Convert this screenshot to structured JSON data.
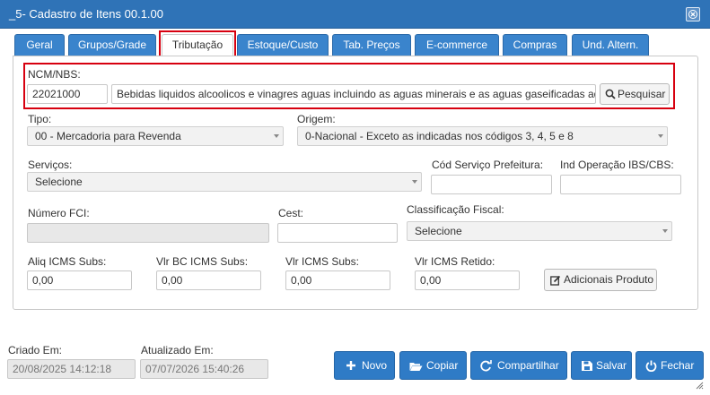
{
  "window": {
    "title": "_5- Cadastro de Itens 00.1.00"
  },
  "tabs": [
    {
      "label": "Geral"
    },
    {
      "label": "Grupos/Grade"
    },
    {
      "label": "Tributação"
    },
    {
      "label": "Estoque/Custo"
    },
    {
      "label": "Tab. Preços"
    },
    {
      "label": "E-commerce"
    },
    {
      "label": "Compras"
    },
    {
      "label": "Und. Altern."
    }
  ],
  "ncm": {
    "label": "NCM/NBS:",
    "code": "22021000",
    "description": "Bebidas liquidos alcoolicos e vinagres aguas incluindo as aguas minerais e as aguas gaseificadas adicionadas",
    "search_label": "Pesquisar"
  },
  "tipo": {
    "label": "Tipo:",
    "value": "00 - Mercadoria para Revenda"
  },
  "origem": {
    "label": "Origem:",
    "value": "0-Nacional - Exceto as indicadas nos códigos 3, 4, 5 e 8"
  },
  "servicos": {
    "label": "Serviços:",
    "value": "Selecione"
  },
  "cod_servico": {
    "label": "Cód Serviço Prefeitura:",
    "value": ""
  },
  "ind_operacao": {
    "label": "Ind Operação IBS/CBS:",
    "value": ""
  },
  "numero_fci": {
    "label": "Número FCI:",
    "value": ""
  },
  "cest": {
    "label": "Cest:",
    "value": ""
  },
  "classificacao": {
    "label": "Classificação Fiscal:",
    "value": "Selecione"
  },
  "aliq_icms_subs": {
    "label": "Aliq ICMS Subs:",
    "value": "0,00"
  },
  "vlr_bc_icms_subs": {
    "label": "Vlr BC ICMS Subs:",
    "value": "0,00"
  },
  "vlr_icms_subs": {
    "label": "Vlr ICMS Subs:",
    "value": "0,00"
  },
  "vlr_icms_retido": {
    "label": "Vlr ICMS Retido:",
    "value": "0,00"
  },
  "adicionais_label": "Adicionais Produto",
  "footer": {
    "criado_label": "Criado Em:",
    "criado_value": "20/08/2025 14:12:18",
    "atualizado_label": "Atualizado Em:",
    "atualizado_value": "07/07/2026 15:40:26",
    "buttons": {
      "novo": "Novo",
      "copiar": "Copiar",
      "compartilhar": "Compartilhar",
      "salvar": "Salvar",
      "fechar": "Fechar"
    }
  },
  "colors": {
    "titlebar": "#2f73b7",
    "tab": "#3a84cc",
    "button": "#2f7bc6",
    "highlight": "#d7000f"
  }
}
